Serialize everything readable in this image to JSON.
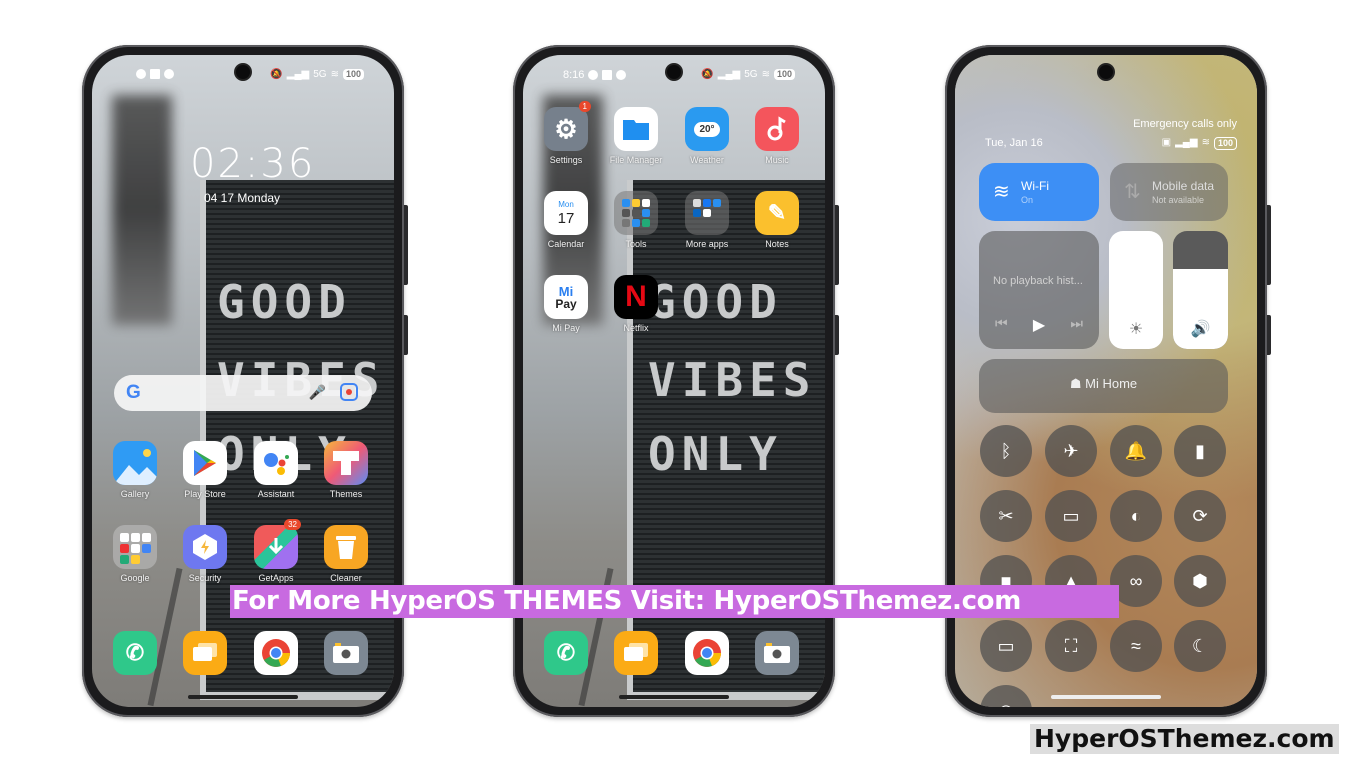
{
  "phone1": {
    "status_bar": {
      "right_network": "5G",
      "battery": "100"
    },
    "clock": "02:36",
    "date": "04 17 Monday",
    "board_lines": [
      "GOOD",
      "VIBES",
      "ONLY"
    ],
    "search": {
      "google": "G",
      "mic_icon": "microphone-icon",
      "lens_icon": "lens-icon"
    },
    "apps_row1": [
      {
        "label": "Gallery",
        "icon": "gallery-icon",
        "color": "#2f9bf4"
      },
      {
        "label": "Play Store",
        "icon": "play-store-icon",
        "color": "#ffffff"
      },
      {
        "label": "Assistant",
        "icon": "assistant-icon",
        "color": "#ffffff"
      },
      {
        "label": "Themes",
        "icon": "themes-icon",
        "color": "#f6b73c"
      }
    ],
    "apps_row2": [
      {
        "label": "Google",
        "icon": "folder-icon",
        "color": "#9c9c9c"
      },
      {
        "label": "Security",
        "icon": "security-icon",
        "color": "#6e78f0"
      },
      {
        "label": "GetApps",
        "icon": "getapps-icon",
        "color": "#f05a5a",
        "badge": "32"
      },
      {
        "label": "Cleaner",
        "icon": "cleaner-icon",
        "color": "#f8a623"
      }
    ],
    "dock": [
      {
        "label": "Phone",
        "icon": "phone-icon",
        "color": "#2fc88a"
      },
      {
        "label": "Messages",
        "icon": "messages-icon",
        "color": "#fbab15"
      },
      {
        "label": "Chrome",
        "icon": "chrome-icon",
        "color": "#ffffff"
      },
      {
        "label": "Camera",
        "icon": "camera-icon",
        "color": "#7d8893"
      }
    ]
  },
  "phone2": {
    "status_bar": {
      "time": "8:16",
      "right_network": "5G",
      "battery": "100"
    },
    "board_lines": [
      "GOOD",
      "VIBES",
      "ONLY"
    ],
    "apps_row1": [
      {
        "label": "Settings",
        "icon": "settings-icon",
        "color": "#76808c",
        "badge": "1"
      },
      {
        "label": "File Manager",
        "icon": "file-manager-icon",
        "color": "#ffffff"
      },
      {
        "label": "Weather",
        "icon": "weather-icon",
        "color": "#2a9af0",
        "text": "20°"
      },
      {
        "label": "Music",
        "icon": "music-icon",
        "color": "#f4555c"
      }
    ],
    "apps_row2": [
      {
        "label": "Calendar",
        "icon": "calendar-icon",
        "color": "#ffffff",
        "day": "Mon",
        "num": "17"
      },
      {
        "label": "Tools",
        "icon": "folder-icon",
        "color": "#9a9a9a"
      },
      {
        "label": "More apps",
        "icon": "folder-icon",
        "color": "#9a9a9a"
      },
      {
        "label": "Notes",
        "icon": "notes-icon",
        "color": "#fbc02d"
      }
    ],
    "apps_row3": [
      {
        "label": "Mi Pay",
        "icon": "mi-pay-icon",
        "color": "#ffffff",
        "text": "Mi Pay"
      },
      {
        "label": "Netflix",
        "icon": "netflix-icon",
        "color": "#000000",
        "text": "N"
      }
    ],
    "dock": [
      {
        "label": "Phone",
        "icon": "phone-icon",
        "color": "#2fc88a"
      },
      {
        "label": "Messages",
        "icon": "messages-icon",
        "color": "#fbab15"
      },
      {
        "label": "Chrome",
        "icon": "chrome-icon",
        "color": "#ffffff"
      },
      {
        "label": "Camera",
        "icon": "camera-icon",
        "color": "#7d8893"
      }
    ]
  },
  "phone3": {
    "emergency": "Emergency calls only",
    "date": "Tue, Jan 16",
    "battery": "100",
    "wifi": {
      "title": "Wi-Fi",
      "sub": "On",
      "color": "#3d8ff5"
    },
    "mobile": {
      "title": "Mobile data",
      "sub": "Not available"
    },
    "media": {
      "text": "No playback hist..."
    },
    "brightness_level": 1.0,
    "volume_level": 0.68,
    "mi_home": "Mi Home",
    "toggles": [
      {
        "name": "bluetooth",
        "glyph": "ᛒ"
      },
      {
        "name": "airplane",
        "glyph": "✈"
      },
      {
        "name": "bell",
        "glyph": "🔔"
      },
      {
        "name": "flashlight",
        "glyph": "▮"
      },
      {
        "name": "screenshot",
        "glyph": "✂"
      },
      {
        "name": "battery-saver",
        "glyph": "▭"
      },
      {
        "name": "dark-mode",
        "glyph": "◐"
      },
      {
        "name": "rotation-lock",
        "glyph": "⟳"
      },
      {
        "name": "screen-record",
        "glyph": "■"
      },
      {
        "name": "cast",
        "glyph": "▲"
      },
      {
        "name": "link",
        "glyph": "∞"
      },
      {
        "name": "settings-hex",
        "glyph": "⬢"
      },
      {
        "name": "card",
        "glyph": "▭"
      },
      {
        "name": "scanner",
        "glyph": "⛶"
      },
      {
        "name": "nfc",
        "glyph": "≈"
      },
      {
        "name": "moon",
        "glyph": "☾"
      }
    ]
  },
  "promo_banner": "For More HyperOS THEMES Visit: HyperOSThemez.com",
  "watermark": "HyperOSThemez.com"
}
